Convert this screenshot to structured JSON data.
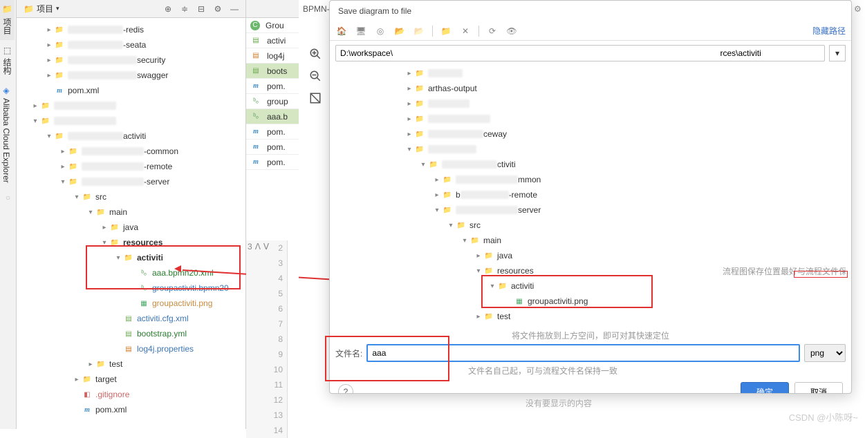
{
  "vstrip": {
    "tabs": [
      "项目",
      "结构",
      "Alibaba Cloud Explorer"
    ]
  },
  "project_panel": {
    "dropdown": "项目",
    "tree": [
      {
        "indent": 40,
        "chev": "right",
        "icon": "folder-blue",
        "text": "-redis",
        "blurw": 80
      },
      {
        "indent": 40,
        "chev": "right",
        "icon": "folder-blue",
        "text": "-seata",
        "blurw": 80
      },
      {
        "indent": 40,
        "chev": "right",
        "icon": "folder-blue",
        "text": "security",
        "blurw": 100
      },
      {
        "indent": 40,
        "chev": "right",
        "icon": "folder-blue",
        "text": "swagger",
        "blurw": 100
      },
      {
        "indent": 40,
        "chev": "none",
        "icon": "mfile",
        "text": "pom.xml"
      },
      {
        "indent": 20,
        "chev": "right",
        "icon": "folder-blue",
        "text": "",
        "blurw": 90
      },
      {
        "indent": 20,
        "chev": "down",
        "icon": "folder-blue",
        "text": "",
        "blurw": 90
      },
      {
        "indent": 40,
        "chev": "down",
        "icon": "folder-blue",
        "text": "activiti",
        "blurw": 80
      },
      {
        "indent": 60,
        "chev": "right",
        "icon": "folder-blue",
        "text": "-common",
        "blurw": 90
      },
      {
        "indent": 60,
        "chev": "right",
        "icon": "folder-blue",
        "text": "-remote",
        "blurw": 90
      },
      {
        "indent": 60,
        "chev": "down",
        "icon": "folder-blue",
        "text": "-server",
        "blurw": 90
      },
      {
        "indent": 80,
        "chev": "down",
        "icon": "folder",
        "text": "src"
      },
      {
        "indent": 100,
        "chev": "down",
        "icon": "folder",
        "text": "main"
      },
      {
        "indent": 120,
        "chev": "right",
        "icon": "folder-blue",
        "text": "java"
      },
      {
        "indent": 120,
        "chev": "down",
        "icon": "folder-orange",
        "text": "resources",
        "bold": true
      },
      {
        "indent": 140,
        "chev": "down",
        "icon": "folder",
        "text": "activiti",
        "bold": true
      },
      {
        "indent": 162,
        "chev": "none",
        "icon": "bfile",
        "text": "aaa.bpmn20.xml",
        "color": "#2a7c30"
      },
      {
        "indent": 162,
        "chev": "none",
        "icon": "bfile",
        "text": "groupactiviti.bpmn20",
        "color": "#3c76b5"
      },
      {
        "indent": 162,
        "chev": "none",
        "icon": "pfile",
        "text": "groupactiviti.png",
        "color": "#c68a3d"
      },
      {
        "indent": 140,
        "chev": "none",
        "icon": "xfile",
        "text": "activiti.cfg.xml",
        "color": "#3c76b5"
      },
      {
        "indent": 140,
        "chev": "none",
        "icon": "xfile",
        "text": "bootstrap.yml",
        "color": "#2a7c30"
      },
      {
        "indent": 140,
        "chev": "none",
        "icon": "gfile",
        "text": "log4j.properties",
        "color": "#3c76b5"
      },
      {
        "indent": 100,
        "chev": "right",
        "icon": "folder",
        "text": "test"
      },
      {
        "indent": 80,
        "chev": "right",
        "icon": "folder-orange",
        "text": "target"
      },
      {
        "indent": 80,
        "chev": "none",
        "icon": "yfile",
        "text": ".gitignore",
        "color": "#c66"
      },
      {
        "indent": 80,
        "chev": "none",
        "icon": "mfile",
        "text": "pom.xml"
      }
    ]
  },
  "editor_tabs": [
    {
      "icon": "c-green",
      "text": "Grou"
    },
    {
      "icon": "xfile",
      "text": "activi"
    },
    {
      "icon": "gfile",
      "text": "log4j"
    },
    {
      "icon": "xfile",
      "text": "boots",
      "active": true
    },
    {
      "icon": "mfile",
      "text": "pom."
    },
    {
      "icon": "bfile",
      "text": "group"
    },
    {
      "icon": "bfile",
      "text": "aaa.b",
      "active": true
    },
    {
      "icon": "mfile",
      "text": "pom."
    },
    {
      "icon": "mfile",
      "text": "pom."
    },
    {
      "icon": "mfile",
      "text": "pom."
    }
  ],
  "gutter_start": 2,
  "gutter_end": 14,
  "gutter_extra": "3",
  "editor_tab_visible": "BPMN-A",
  "dialog": {
    "title": "Save diagram to file",
    "hide_path_link": "隐藏路径",
    "path_value": "D:\\workspace\\                                                                                                                                              rces\\activiti",
    "file_tree": [
      {
        "indent": 100,
        "chev": "right",
        "icon": "folder",
        "text": "",
        "blurw": 50
      },
      {
        "indent": 100,
        "chev": "right",
        "icon": "folder",
        "text": "arthas-output"
      },
      {
        "indent": 100,
        "chev": "right",
        "icon": "folder",
        "text": "",
        "blurw": 60
      },
      {
        "indent": 100,
        "chev": "right",
        "icon": "folder",
        "text": "",
        "blurw": 90
      },
      {
        "indent": 100,
        "chev": "right",
        "icon": "folder",
        "text": "ceway",
        "blurw": 80
      },
      {
        "indent": 100,
        "chev": "down",
        "icon": "folder",
        "text": "",
        "blurw": 70
      },
      {
        "indent": 120,
        "chev": "down",
        "icon": "folder",
        "text": "ctiviti",
        "blurw": 80
      },
      {
        "indent": 140,
        "chev": "right",
        "icon": "folder",
        "text": "mmon",
        "blurw": 90
      },
      {
        "indent": 140,
        "chev": "right",
        "icon": "folder",
        "text": "-remote",
        "blurw": 70,
        "prefix": "b"
      },
      {
        "indent": 140,
        "chev": "down",
        "icon": "folder",
        "text": "server",
        "blurw": 90
      },
      {
        "indent": 160,
        "chev": "down",
        "icon": "folder",
        "text": "src"
      },
      {
        "indent": 180,
        "chev": "down",
        "icon": "folder",
        "text": "main"
      },
      {
        "indent": 200,
        "chev": "right",
        "icon": "folder",
        "text": "java"
      },
      {
        "indent": 200,
        "chev": "down",
        "icon": "folder",
        "text": "resources",
        "annotation": "流程图保存位置最好与流程文件保持一致"
      },
      {
        "indent": 220,
        "chev": "down",
        "icon": "folder",
        "text": "activiti"
      },
      {
        "indent": 244,
        "chev": "none",
        "icon": "pfile",
        "text": "groupactiviti.png"
      },
      {
        "indent": 200,
        "chev": "right",
        "icon": "folder",
        "text": "test"
      }
    ],
    "drop_hint": "将文件拖放到上方空间，即可对其快速定位",
    "filename_label": "文件名:",
    "filename_value": "aaa",
    "filename_hint": "文件名自己起，可与流程文件名保持一致",
    "ext_value": "png",
    "ok_label": "确定",
    "cancel_label": "取消"
  },
  "below_dialog_hint": "没有要显示的内容",
  "watermark": "CSDN @小陈呀~"
}
